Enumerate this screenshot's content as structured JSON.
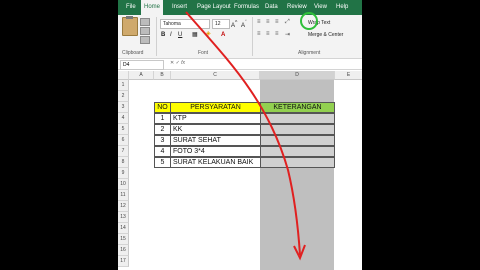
{
  "ribbon": {
    "tabs": [
      "File",
      "Home",
      "Insert",
      "Page Layout",
      "Formulas",
      "Data",
      "Review",
      "View",
      "Help"
    ],
    "active_tab": "Home",
    "font_name": "Tahoma",
    "font_size": "12",
    "groups": {
      "clipboard": "Clipboard",
      "font": "Font",
      "alignment": "Alignment"
    },
    "wrap_text": "Wrap Text",
    "merge_center": "Merge & Center",
    "bold": "B",
    "italic": "I",
    "underline": "U"
  },
  "formula_bar": {
    "name_box": "D4",
    "fx": "fx"
  },
  "columns": [
    "A",
    "B",
    "C",
    "D",
    "E"
  ],
  "rows": [
    "1",
    "2",
    "3",
    "4",
    "5",
    "6",
    "7",
    "8",
    "9",
    "10",
    "11",
    "12",
    "13",
    "14",
    "15",
    "16",
    "17"
  ],
  "table": {
    "headers": [
      "NO",
      "PERSYARATAN",
      "KETERANGAN"
    ],
    "rows": [
      {
        "no": "1",
        "item": "KTP"
      },
      {
        "no": "2",
        "item": "KK"
      },
      {
        "no": "3",
        "item": "SURAT SEHAT"
      },
      {
        "no": "4",
        "item": "FOTO 3*4"
      },
      {
        "no": "5",
        "item": "SURAT KELAKUAN BAIK"
      }
    ]
  },
  "colors": {
    "ribbon": "#217346",
    "header_yellow": "#ffff00",
    "header_green": "#92d050",
    "arrow": "#e02020"
  }
}
